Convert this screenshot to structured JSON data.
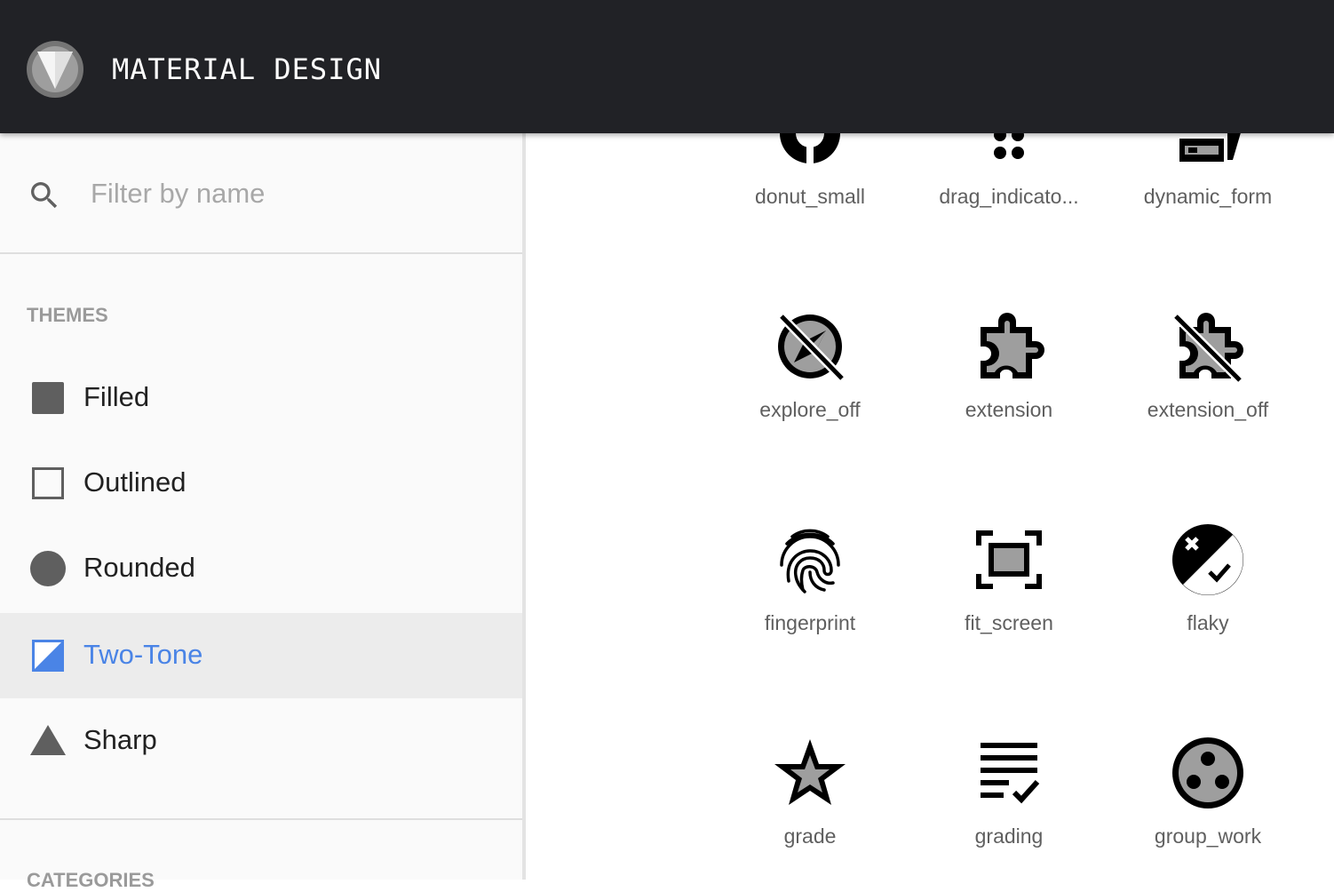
{
  "header": {
    "title": "MATERIAL DESIGN",
    "logo_icon": "material-design-logo"
  },
  "search": {
    "placeholder": "Filter by name",
    "value": "",
    "icon": "search-icon"
  },
  "themes": {
    "label": "THEMES",
    "items": [
      {
        "label": "Filled",
        "icon": "filled-square-icon",
        "selected": false
      },
      {
        "label": "Outlined",
        "icon": "outlined-square-icon",
        "selected": false
      },
      {
        "label": "Rounded",
        "icon": "rounded-circle-icon",
        "selected": false
      },
      {
        "label": "Two-Tone",
        "icon": "two-tone-square-icon",
        "selected": true
      },
      {
        "label": "Sharp",
        "icon": "sharp-triangle-icon",
        "selected": false
      }
    ]
  },
  "categories": {
    "label": "CATEGORIES"
  },
  "colors": {
    "accent": "#4a84e6",
    "topbar": "#212226",
    "sidebar": "#fafafa",
    "selected_row": "#ececec"
  },
  "icons": [
    {
      "name": "donut_small",
      "icon": "donut-small-icon"
    },
    {
      "name": "drag_indicato...",
      "icon": "drag-indicator-icon"
    },
    {
      "name": "dynamic_form",
      "icon": "dynamic-form-icon"
    },
    {
      "name": "explore_off",
      "icon": "explore-off-icon"
    },
    {
      "name": "extension",
      "icon": "extension-icon"
    },
    {
      "name": "extension_off",
      "icon": "extension-off-icon"
    },
    {
      "name": "fingerprint",
      "icon": "fingerprint-icon"
    },
    {
      "name": "fit_screen",
      "icon": "fit-screen-icon"
    },
    {
      "name": "flaky",
      "icon": "flaky-icon"
    },
    {
      "name": "grade",
      "icon": "grade-icon"
    },
    {
      "name": "grading",
      "icon": "grading-icon"
    },
    {
      "name": "group_work",
      "icon": "group-work-icon"
    }
  ]
}
